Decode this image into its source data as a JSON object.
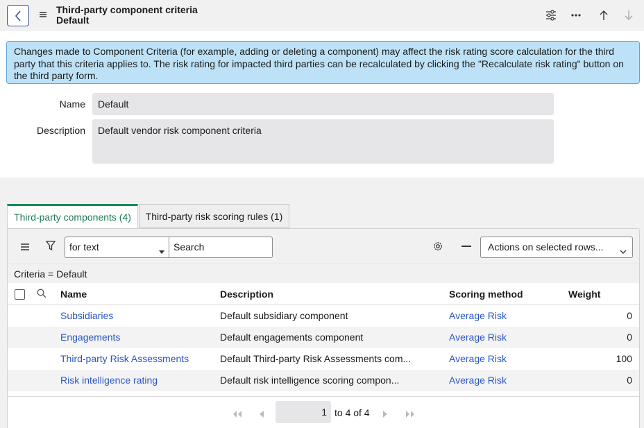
{
  "header": {
    "title": "Third-party component criteria",
    "subtitle": "Default"
  },
  "banner": {
    "text": "Changes made to Component Criteria (for example, adding or deleting a component) may affect the risk rating score calculation for the third party that this criteria applies to. The risk rating for impacted third parties can be recalculated by clicking the \"Recalculate risk rating\" button on the third party form."
  },
  "form": {
    "name_label": "Name",
    "name_value": "Default",
    "description_label": "Description",
    "description_value": "Default vendor risk component criteria"
  },
  "tabs": [
    {
      "label": "Third-party components (4)"
    },
    {
      "label": "Third-party risk scoring rules (1)"
    }
  ],
  "toolbar": {
    "search_field": "for text",
    "search_placeholder": "Search",
    "actions_label": "Actions on selected rows..."
  },
  "filter": {
    "text": "Criteria = Default"
  },
  "table": {
    "columns": [
      "Name",
      "Description",
      "Scoring method",
      "Weight"
    ],
    "rows": [
      {
        "name": "Subsidiaries",
        "description": "Default subsidiary component",
        "method": "Average Risk",
        "weight": "0"
      },
      {
        "name": "Engagements",
        "description": "Default engagements component",
        "method": "Average Risk",
        "weight": "0"
      },
      {
        "name": "Third-party Risk Assessments",
        "description": "Default Third-party Risk Assessments com...",
        "method": "Average Risk",
        "weight": "100"
      },
      {
        "name": "Risk intelligence rating",
        "description": "Default risk intelligence scoring compon...",
        "method": "Average Risk",
        "weight": "0"
      }
    ]
  },
  "pager": {
    "current": "1",
    "range": "to 4 of 4"
  },
  "colors": {
    "accent_tab": "#1a8a5c",
    "link": "#2857c2",
    "banner_bg": "#bde2f7"
  }
}
